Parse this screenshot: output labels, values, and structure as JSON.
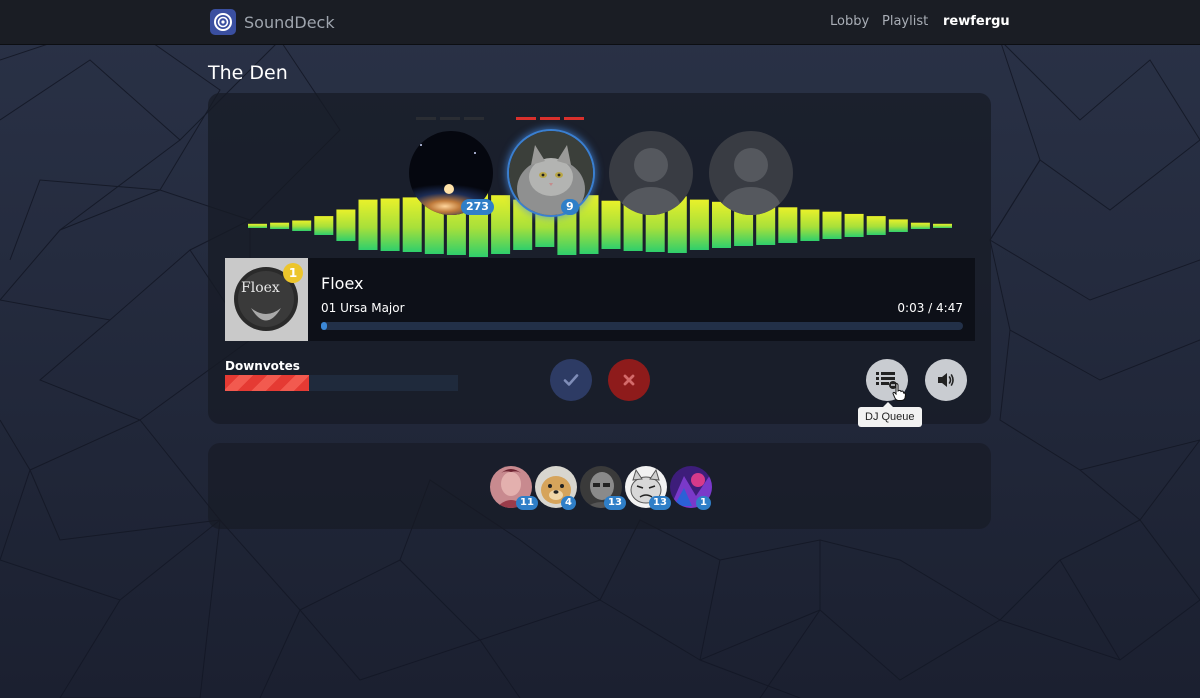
{
  "app": {
    "name": "SoundDeck"
  },
  "nav": {
    "lobby": "Lobby",
    "playlist": "Playlist",
    "user": "rewfergu"
  },
  "room": {
    "title": "The Den"
  },
  "djs": [
    {
      "label": "earth-at-night",
      "badge": "273",
      "state": "normal"
    },
    {
      "label": "gray-cat",
      "badge": "9",
      "state": "active"
    },
    {
      "label": "empty-seat",
      "badge": "",
      "state": "empty"
    },
    {
      "label": "empty-seat",
      "badge": "",
      "state": "empty"
    }
  ],
  "now_playing": {
    "artist": "Floex",
    "track": "01 Ursa Major",
    "time": "0:03 / 4:47",
    "progress": 0.01,
    "queue_position": "1"
  },
  "downvotes": {
    "label": "Downvotes",
    "fraction": 0.36
  },
  "visualizer": {
    "bars": [
      4,
      6,
      10,
      18,
      30,
      48,
      50,
      52,
      56,
      58,
      62,
      56,
      48,
      42,
      58,
      56,
      46,
      50,
      52,
      54,
      48,
      44,
      40,
      38,
      34,
      30,
      26,
      22,
      18,
      12,
      6,
      4
    ]
  },
  "controls": {
    "upvote_icon": "check-icon",
    "downvote_icon": "close-icon",
    "queue_icon": "list-icon",
    "volume_icon": "volume-icon",
    "tooltip": "DJ Queue"
  },
  "audience": [
    {
      "name": "pink-portrait",
      "badge": "11"
    },
    {
      "name": "dog",
      "badge": "4"
    },
    {
      "name": "bald-man",
      "badge": "13"
    },
    {
      "name": "grumpy-cat",
      "badge": "13"
    },
    {
      "name": "purple-art",
      "badge": "1"
    }
  ],
  "colors": {
    "accent": "#2f7fc8",
    "downvote": "#e53a33",
    "viz_top": "#e8f22a",
    "viz_bottom": "#2ecc71"
  }
}
